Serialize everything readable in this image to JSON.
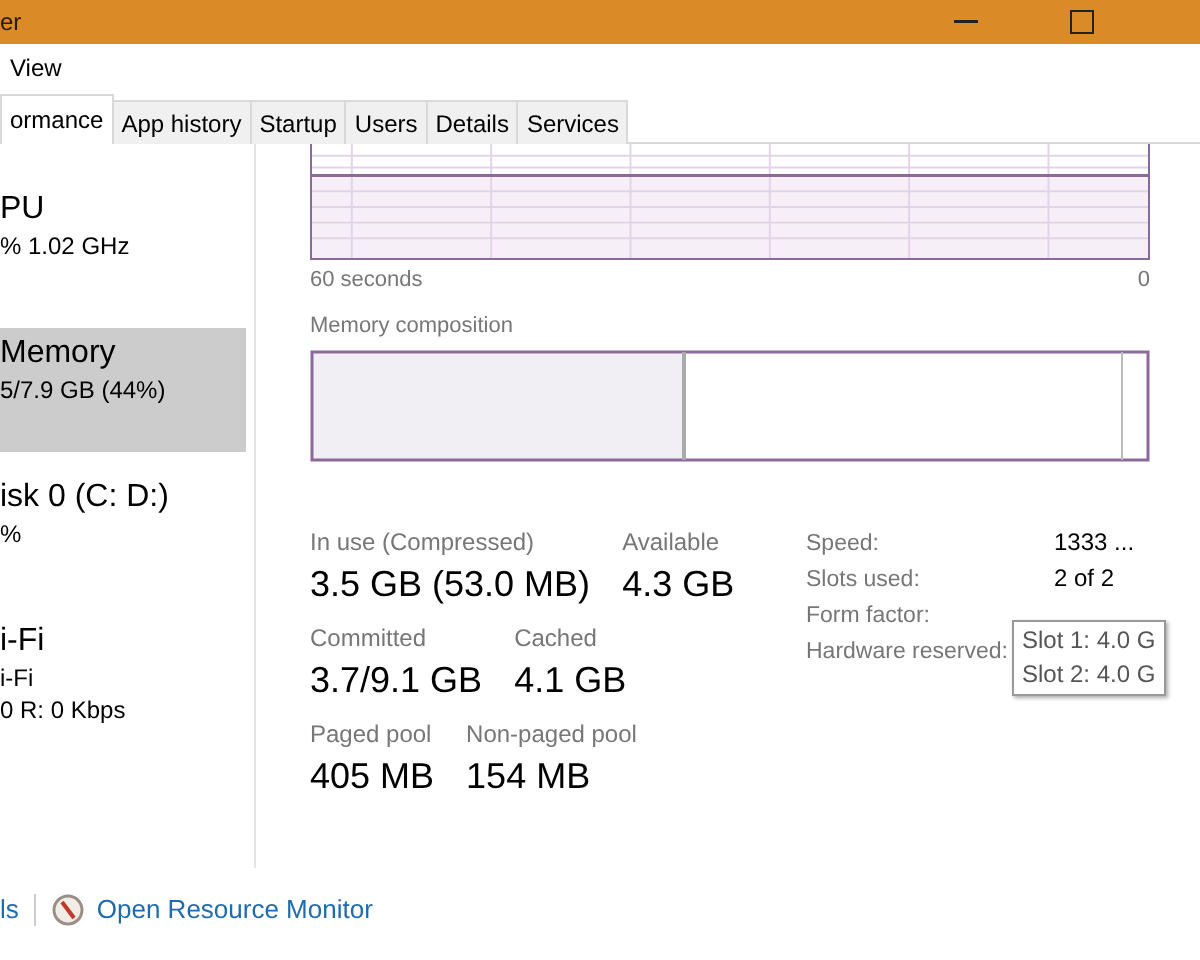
{
  "window": {
    "title": "er"
  },
  "menu": [
    "View"
  ],
  "tabs": [
    {
      "label": "ormance",
      "selected": true
    },
    {
      "label": "App history",
      "selected": false
    },
    {
      "label": "Startup",
      "selected": false
    },
    {
      "label": "Users",
      "selected": false
    },
    {
      "label": "Details",
      "selected": false
    },
    {
      "label": "Services",
      "selected": false
    }
  ],
  "sidebar": {
    "items": [
      {
        "name": "PU",
        "detail": "% 1.02 GHz",
        "selected": false
      },
      {
        "name": "Memory",
        "detail": "5/7.9 GB (44%)",
        "selected": true
      },
      {
        "name": "isk 0 (C: D:)",
        "detail": "%",
        "selected": false
      },
      {
        "name": "i-Fi",
        "detail": "i-Fi",
        "detail2": "0 R: 0 Kbps",
        "selected": false
      }
    ]
  },
  "graph": {
    "x_start": "60 seconds",
    "x_end": "0"
  },
  "composition": {
    "title": "Memory composition"
  },
  "stats": [
    [
      {
        "label": "In use (Compressed)",
        "value": "3.5 GB (53.0 MB)"
      },
      {
        "label": "Available",
        "value": "4.3 GB"
      }
    ],
    [
      {
        "label": "Committed",
        "value": "3.7/9.1 GB"
      },
      {
        "label": "Cached",
        "value": "4.1 GB"
      }
    ],
    [
      {
        "label": "Paged pool",
        "value": "405 MB"
      },
      {
        "label": "Non-paged pool",
        "value": "154 MB"
      }
    ]
  ],
  "details": [
    {
      "label": "Speed:",
      "value": "1333 ..."
    },
    {
      "label": "Slots used:",
      "value": "2 of 2"
    },
    {
      "label": "Form factor:"
    },
    {
      "label": "Hardware reserved:"
    }
  ],
  "tooltip": [
    "Slot 1: 4.0 G",
    "Slot 2: 4.0 G"
  ],
  "footer": {
    "fewer_details": "ls",
    "resource_monitor": "Open Resource Monitor"
  }
}
